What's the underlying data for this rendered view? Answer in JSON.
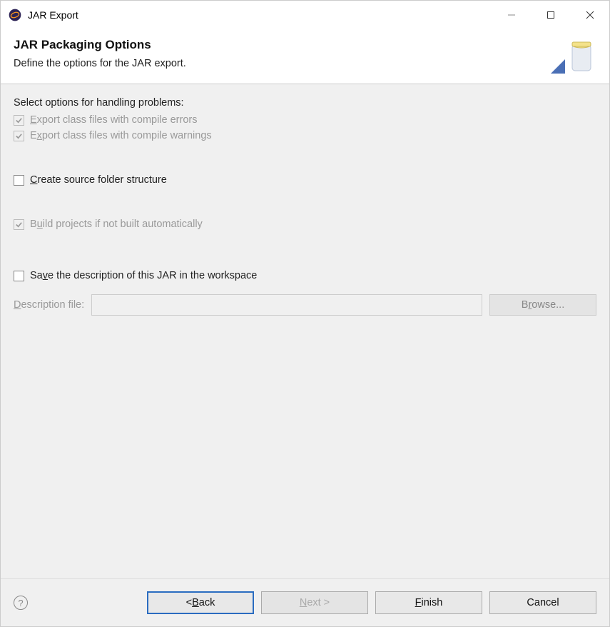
{
  "window": {
    "title": "JAR Export"
  },
  "banner": {
    "title": "JAR Packaging Options",
    "subtitle": "Define the options for the JAR export."
  },
  "body": {
    "problems_label": "Select options for handling problems:",
    "export_errors": {
      "label_pre": "",
      "label_key": "E",
      "label_post": "xport class files with compile errors",
      "checked": true,
      "enabled": false
    },
    "export_warnings": {
      "label_pre": "E",
      "label_key": "x",
      "label_post": "port class files with compile warnings",
      "checked": true,
      "enabled": false
    },
    "create_source": {
      "label_pre": "",
      "label_key": "C",
      "label_post": "reate source folder structure",
      "checked": false,
      "enabled": true
    },
    "build_projects": {
      "label_pre": "B",
      "label_key": "u",
      "label_post": "ild projects if not built automatically",
      "checked": true,
      "enabled": false
    },
    "save_description": {
      "label_pre": "Sa",
      "label_key": "v",
      "label_post": "e the description of this JAR in the workspace",
      "checked": false,
      "enabled": true
    },
    "desc_file_label_pre": "",
    "desc_file_label_key": "D",
    "desc_file_label_post": "escription file:",
    "desc_file_value": "",
    "browse_pre": "B",
    "browse_key": "r",
    "browse_post": "owse..."
  },
  "buttons": {
    "back_pre": "< ",
    "back_key": "B",
    "back_post": "ack",
    "next_pre": "",
    "next_key": "N",
    "next_post": "ext >",
    "finish_pre": "",
    "finish_key": "F",
    "finish_post": "inish",
    "cancel": "Cancel",
    "help": "?"
  }
}
